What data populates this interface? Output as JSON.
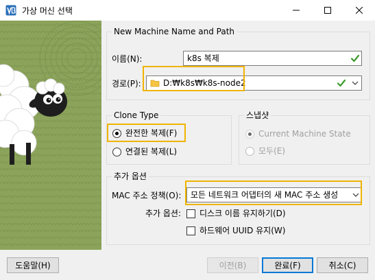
{
  "window": {
    "title": "가상 머신 선택",
    "controls": {
      "minimize": "—",
      "maximize": "☐",
      "close": "✕"
    }
  },
  "name_path_group": {
    "legend": "New Machine Name and Path",
    "name_label": "이름(N):",
    "name_value": "k8s 복제",
    "path_label": "경로(P):",
    "path_value": "D:₩k8s₩k8s-node2"
  },
  "clone_type": {
    "legend": "Clone Type",
    "full_clone": "완전한 복제(F)",
    "linked_clone": "연결된 복제(L)"
  },
  "snapshot": {
    "legend": "스냅샷",
    "current_state": "Current Machine State",
    "all": "모두(E)"
  },
  "extra_options": {
    "legend": "추가 옵션",
    "mac_policy_label": "MAC 주소 정책(O):",
    "mac_policy_value": "모든 네트워크 어댑터의 새 MAC 주소 생성",
    "options_label": "추가 옵션:",
    "keep_disk_names": "디스크 이름 유지하기(D)",
    "keep_hw_uuid": "하드웨어 UUID 유지(W)"
  },
  "buttons": {
    "help": "도움말(H)",
    "back": "이전(B)",
    "finish": "완료(F)",
    "cancel": "취소(C)"
  },
  "colors": {
    "highlight": "#f0b400",
    "check_ok": "#3a9a2a",
    "primary_border": "#0078d7"
  }
}
